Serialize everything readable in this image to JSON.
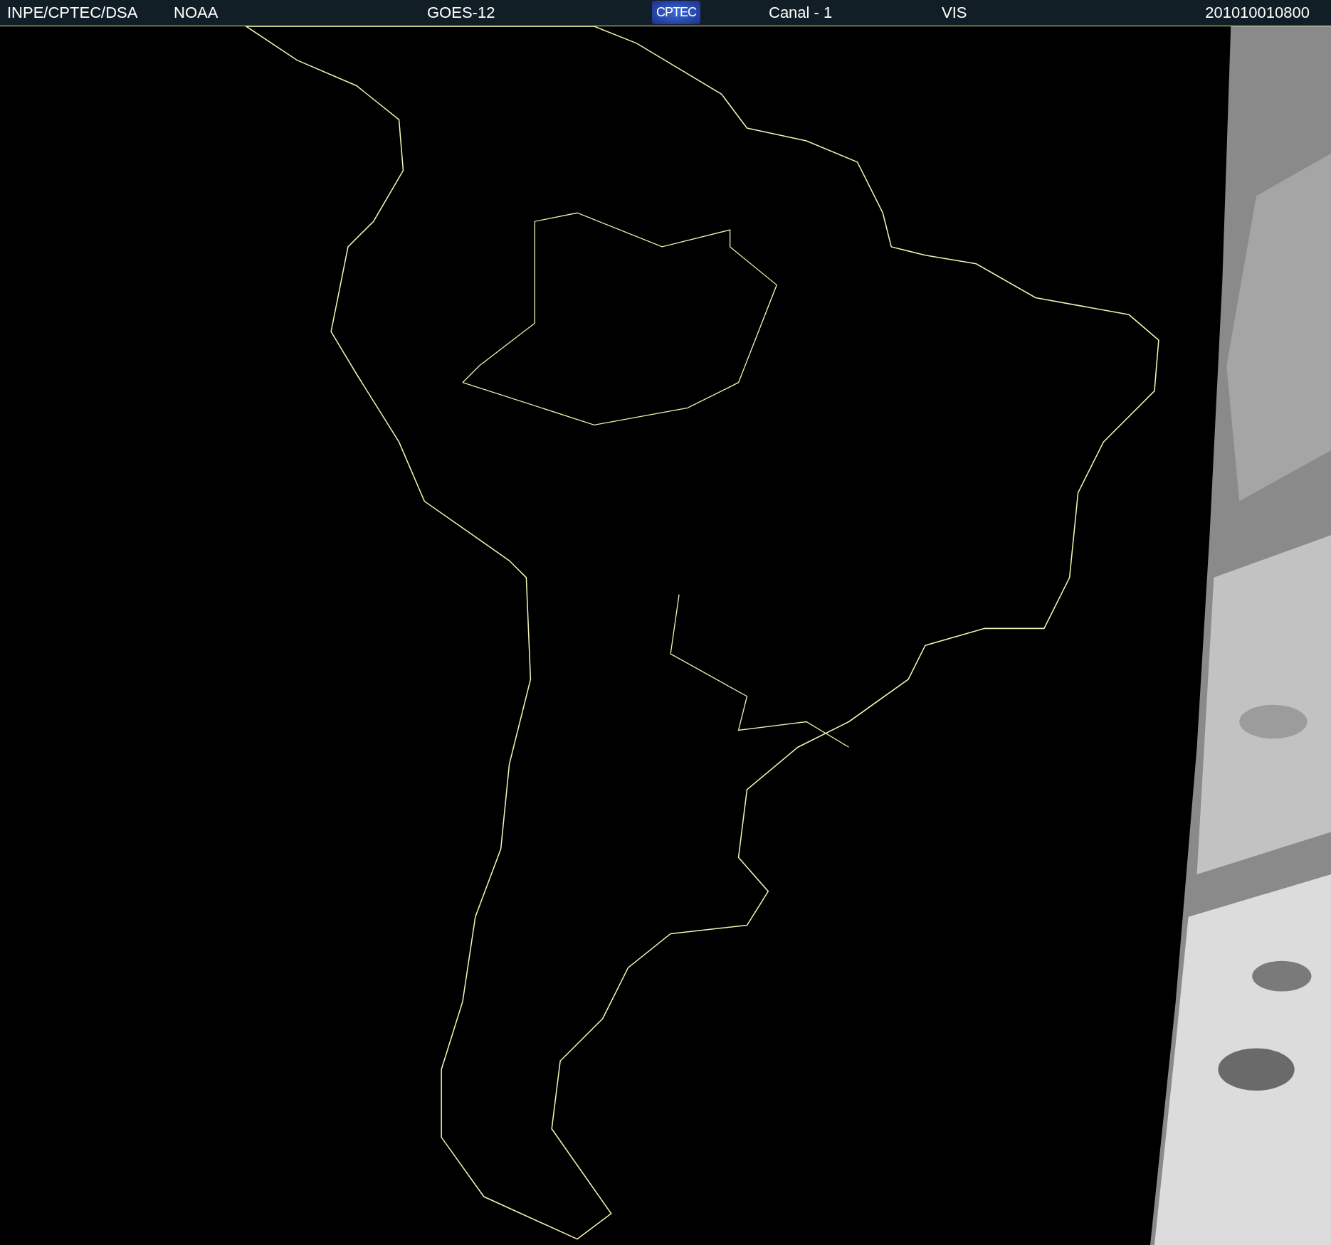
{
  "header": {
    "source": "INPE/CPTEC/DSA",
    "agency": "NOAA",
    "satellite": "GOES-12",
    "logo": "CPTEC",
    "channel": "Canal - 1",
    "band": "VIS",
    "timestamp": "201010010800"
  }
}
